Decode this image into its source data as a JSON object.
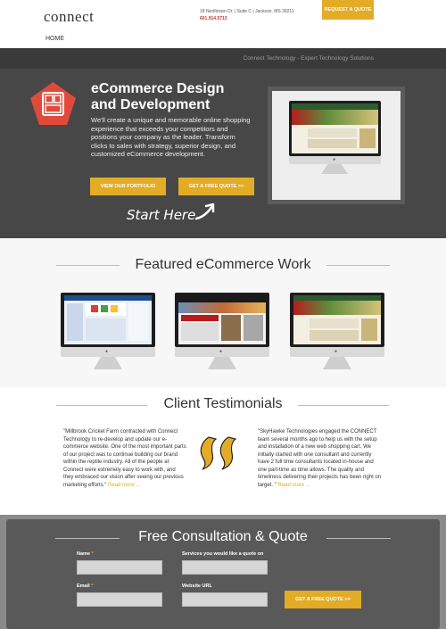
{
  "header": {
    "logo_text": "connect",
    "address": "18 Northtown Dr. | Suite C | Jackson, MS 39211",
    "phone": "601.914.5713",
    "quote_button": "Request a Quote",
    "nav_home": "HOME"
  },
  "hero": {
    "tagline": "Connect Technology - Expert Technology Solutions",
    "title_line1": "eCommerce Design",
    "title_line2": "and Development",
    "body": "We'll create a unique and memorable online shopping experience that exceeds your competitors and positions your company as the leader. Transform clicks to sales with strategy, superior design, and customized eCommerce development.",
    "portfolio_button": "View our Portfolio",
    "free_quote_button": "Get a Free Quote >>",
    "start_here": "Start Here"
  },
  "featured": {
    "title": "Featured eCommerce Work"
  },
  "testimonials": {
    "title": "Client Testimonials",
    "left_quote": "\"Millbrook Cricket Farm contracted with Connect Technology to re-develop and update our e-commerce website. One of the most important parts of our project was to continue building our brand within the reptile industry. All of the people at Connect were extremely easy to work with, and they embraced our vision after seeing our previous marketing efforts.\"",
    "right_quote": "\"SkyHawke Technologies engaged the CONNECT team several months ago to help us with the setup and installation of a new web shopping cart. We initially started with one consultant and currently have 2 full time consultants located in-house and one part-time as time allows. The quality and timeliness delivering their projects has been right on target. \"",
    "read_more": "Read more ..."
  },
  "consultation": {
    "title": "Free Consultation & Quote",
    "name_label": "Name",
    "services_label": "Services you would like a quote on",
    "email_label": "Email",
    "website_label": "Website URL",
    "submit_button": "Get a Free Quote >>",
    "required_mark": "*"
  },
  "colors": {
    "accent": "#e2ac27",
    "brand_red": "#c0392b",
    "hero_bg": "#474747"
  },
  "icons": {
    "hero_icon": "pentagon-layout-icon",
    "quote_icon": "quotation-mark-icon",
    "arrow": "curved-arrow-icon"
  }
}
